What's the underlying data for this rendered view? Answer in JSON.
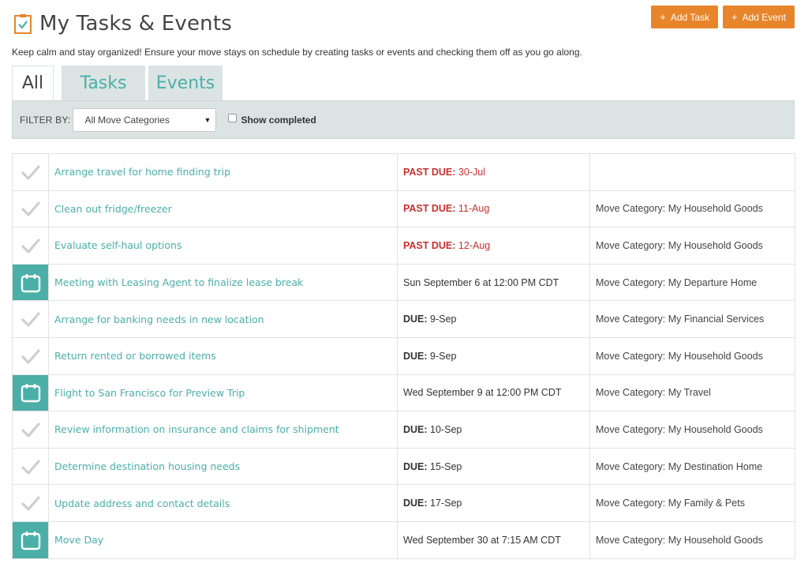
{
  "header": {
    "title": "My Tasks & Events"
  },
  "actions": {
    "add_task": "Add Task",
    "add_event": "Add Event",
    "plus": "+"
  },
  "intro": "Keep calm and stay organized! Ensure your move stays on schedule by creating tasks or events and checking them off as you go along.",
  "tabs": [
    {
      "label": "All",
      "active": true
    },
    {
      "label": "Tasks",
      "active": false
    },
    {
      "label": "Events",
      "active": false
    }
  ],
  "filter": {
    "label": "FILTER BY:",
    "selected": "All Move Categories",
    "show_completed": "Show completed"
  },
  "colors": {
    "accent": "#4bafa8",
    "orange": "#e8852a",
    "past_due": "#c8302e"
  },
  "rows": [
    {
      "type": "task",
      "icon": "checkmark-icon",
      "title": "Arrange travel for home finding trip",
      "due_label": "PAST DUE:",
      "due_date": "30-Jul",
      "past_due": true,
      "category": ""
    },
    {
      "type": "task",
      "icon": "checkmark-icon",
      "title": "Clean out fridge/freezer",
      "due_label": "PAST DUE:",
      "due_date": "11-Aug",
      "past_due": true,
      "category": "Move Category: My Household Goods"
    },
    {
      "type": "task",
      "icon": "checkmark-icon",
      "title": "Evaluate self-haul options",
      "due_label": "PAST DUE:",
      "due_date": "12-Aug",
      "past_due": true,
      "category": "Move Category: My Household Goods"
    },
    {
      "type": "event",
      "icon": "calendar-icon",
      "title": "Meeting with Leasing Agent to finalize lease break",
      "when": "Sun September 6 at 12:00 PM CDT",
      "category": "Move Category: My Departure Home"
    },
    {
      "type": "task",
      "icon": "checkmark-icon",
      "title": "Arrange for banking needs in new location",
      "due_label": "DUE:",
      "due_date": "9-Sep",
      "past_due": false,
      "category": "Move Category: My Financial Services"
    },
    {
      "type": "task",
      "icon": "checkmark-icon",
      "title": "Return rented or borrowed items",
      "due_label": "DUE:",
      "due_date": "9-Sep",
      "past_due": false,
      "category": "Move Category: My Household Goods"
    },
    {
      "type": "event",
      "icon": "calendar-icon",
      "title": "Flight to San Francisco for Preview Trip",
      "when": "Wed September 9 at 12:00 PM CDT",
      "category": "Move Category: My Travel"
    },
    {
      "type": "task",
      "icon": "checkmark-icon",
      "title": "Review information on insurance and claims for shipment",
      "due_label": "DUE:",
      "due_date": "10-Sep",
      "past_due": false,
      "category": "Move Category: My Household Goods"
    },
    {
      "type": "task",
      "icon": "checkmark-icon",
      "title": "Determine destination housing needs",
      "due_label": "DUE:",
      "due_date": "15-Sep",
      "past_due": false,
      "category": "Move Category: My Destination Home"
    },
    {
      "type": "task",
      "icon": "checkmark-icon",
      "title": "Update address and contact details",
      "due_label": "DUE:",
      "due_date": "17-Sep",
      "past_due": false,
      "category": "Move Category: My Family & Pets"
    },
    {
      "type": "event",
      "icon": "calendar-icon",
      "title": "Move Day",
      "when": "Wed September 30 at 7:15 AM CDT",
      "category": "Move Category: My Household Goods"
    }
  ]
}
